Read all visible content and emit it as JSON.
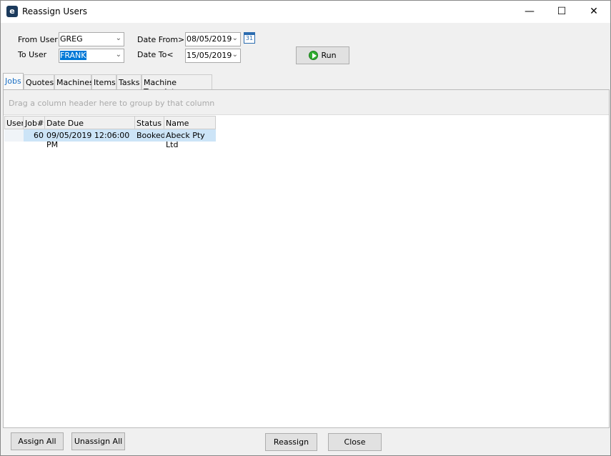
{
  "window": {
    "title": "Reassign Users",
    "minimize": "—",
    "maximize": "☐",
    "close": "✕"
  },
  "filters": {
    "from_user_label": "From User",
    "from_user": "GREG",
    "to_user_label": "To User",
    "to_user": "FRANK",
    "date_from_label": "Date From>",
    "date_from": "08/05/2019",
    "date_to_label": "Date To<",
    "date_to": "15/05/2019",
    "calendar_day": "31",
    "run_label": "Run"
  },
  "tabs": [
    {
      "label": "Jobs",
      "active": true
    },
    {
      "label": "Quotes"
    },
    {
      "label": "Machines"
    },
    {
      "label": "Items"
    },
    {
      "label": "Tasks"
    },
    {
      "label": "Machine Templates"
    }
  ],
  "grid": {
    "group_hint": "Drag a column header here to group by that column",
    "columns": [
      "User",
      "Job#",
      "Date Due",
      "Status",
      "Name"
    ],
    "rows": [
      {
        "user": "",
        "job": "60",
        "date_due": "09/05/2019 12:06:00 PM",
        "status": "Booked",
        "name": "Abeck Pty Ltd"
      }
    ]
  },
  "footer": {
    "assign_all": "Assign All",
    "unassign_all": "Unassign All",
    "reassign": "Reassign",
    "close": "Close"
  }
}
